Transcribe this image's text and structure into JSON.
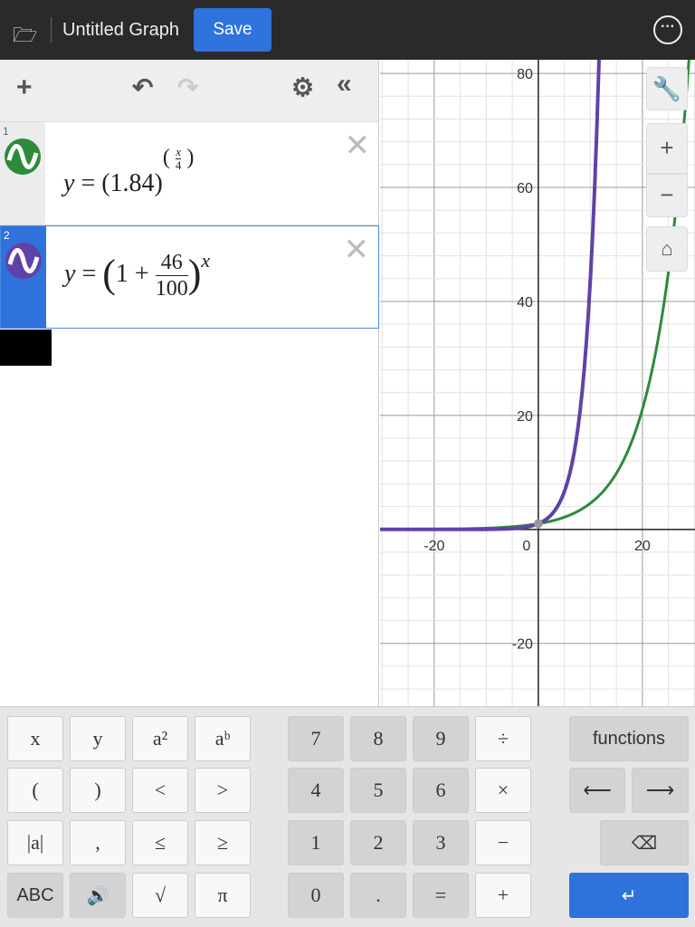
{
  "header": {
    "title": "Untitled Graph",
    "save_label": "Save"
  },
  "expressions": [
    {
      "index": "1",
      "color": "#2d8a3a",
      "base": "(1.84)",
      "exp_num": "x",
      "exp_den": "4"
    },
    {
      "index": "2",
      "color": "#6042a6",
      "one": "1",
      "plus": "+",
      "num": "46",
      "den": "100",
      "exp": "x"
    }
  ],
  "graph": {
    "x_ticks": [
      "-20",
      "0",
      "20"
    ],
    "y_ticks": [
      "80",
      "60",
      "40",
      "20",
      "-20"
    ]
  },
  "chart_data": {
    "type": "line",
    "xlim": [
      -30.4,
      30.1
    ],
    "ylim": [
      -31,
      82.4
    ],
    "grid": true,
    "series": [
      {
        "name": "y=(1.84)^(x/4)",
        "color": "#2d8a3a"
      },
      {
        "name": "y=(1+46/100)^x",
        "color": "#6042a6"
      }
    ]
  },
  "keypad": {
    "left": [
      [
        "x",
        "y",
        "a²",
        "aᵇ"
      ],
      [
        "(",
        ")",
        "<",
        ">"
      ],
      [
        "|a|",
        ",",
        "≤",
        "≥"
      ],
      [
        "ABC",
        "🔊",
        "√",
        "π"
      ]
    ],
    "mid": [
      [
        "7",
        "8",
        "9",
        "÷"
      ],
      [
        "4",
        "5",
        "6",
        "×"
      ],
      [
        "1",
        "2",
        "3",
        "−"
      ],
      [
        "0",
        ".",
        "=",
        "+"
      ]
    ],
    "functions": "functions",
    "left_arrow": "⟵",
    "right_arrow": "⟶",
    "backspace": "⌫",
    "enter": "↵"
  }
}
